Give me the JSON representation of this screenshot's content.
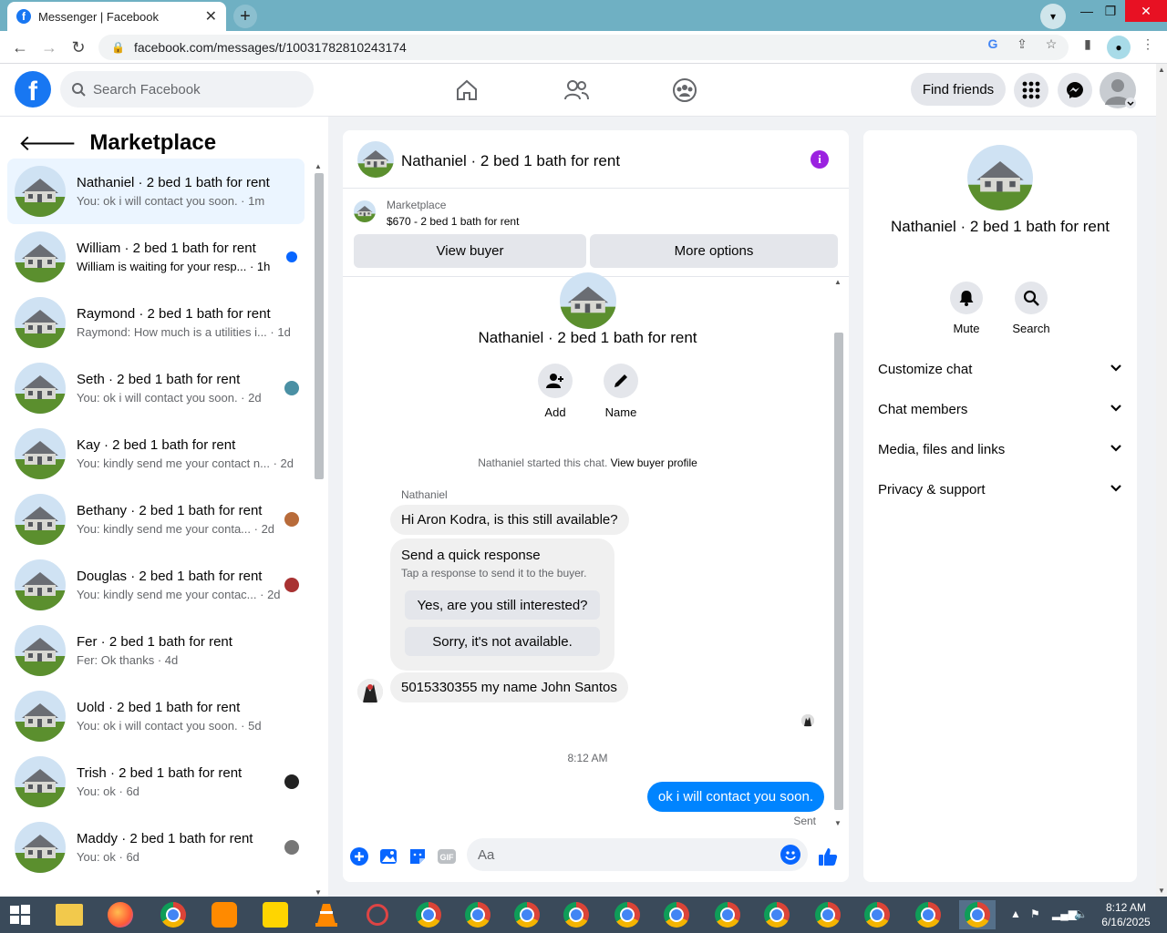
{
  "browser": {
    "tab_title": "Messenger | Facebook",
    "tab_close": "✕",
    "new_tab": "+",
    "url": "facebook.com/messages/t/10031782810243174",
    "win_minimize": "—",
    "win_restore": "❐",
    "win_close": "✕"
  },
  "fbnav": {
    "logo": "f",
    "search_placeholder": "Search Facebook",
    "find_friends": "Find friends"
  },
  "sidebar": {
    "title": "Marketplace",
    "conversations": [
      {
        "name": "Nathaniel · 2 bed 1 bath for rent",
        "preview": "You: ok i will contact you soon. · 1m",
        "active": true
      },
      {
        "name": "William · 2 bed 1 bath for rent",
        "preview": "William is waiting for your resp... · 1h",
        "unread": true
      },
      {
        "name": "Raymond · 2 bed 1 bath for rent",
        "preview": "Raymond: How much is a utilities i... · 1d"
      },
      {
        "name": "Seth · 2 bed 1 bath for rent",
        "preview": "You: ok i will contact you soon. · 2d"
      },
      {
        "name": "Kay · 2 bed 1 bath for rent",
        "preview": "You: kindly send me your contact n... · 2d"
      },
      {
        "name": "Bethany · 2 bed 1 bath for rent",
        "preview": "You: kindly send me your conta... · 2d"
      },
      {
        "name": "Douglas · 2 bed 1 bath for rent",
        "preview": "You: kindly send me your contac... · 2d"
      },
      {
        "name": "Fer · 2 bed 1 bath for rent",
        "preview": "Fer: Ok thanks · 4d"
      },
      {
        "name": "Uold · 2 bed 1 bath for rent",
        "preview": "You: ok i will contact you soon. · 5d"
      },
      {
        "name": "Trish · 2 bed 1 bath for rent",
        "preview": "You: ok · 6d"
      },
      {
        "name": "Maddy · 2 bed 1 bath for rent",
        "preview": "You: ok · 6d"
      }
    ]
  },
  "chat": {
    "title": "Nathaniel · 2 bed 1 bath for rent",
    "marketplace_label": "Marketplace",
    "listing": "$670 - 2 bed 1 bath for rent",
    "view_buyer": "View buyer",
    "more_options": "More options",
    "thread_title": "Nathaniel · 2 bed 1 bath for rent",
    "add_label": "Add",
    "name_label": "Name",
    "started_text": "Nathaniel started this chat.",
    "view_buyer_profile": "View buyer profile",
    "sender_name": "Nathaniel",
    "msg1": "Hi Aron Kodra, is this still available?",
    "quick_title": "Send a quick response",
    "quick_sub": "Tap a response to send it to the buyer.",
    "quick_opt1": "Yes, are you still interested?",
    "quick_opt2": "Sorry, it's not available.",
    "msg2": "5015330355 my name John Santos",
    "timestamp": "8:12 AM",
    "my_msg": "ok i will contact you soon.",
    "status": "Sent",
    "composer_placeholder": "Aa"
  },
  "details": {
    "title": "Nathaniel · 2 bed 1 bath for rent",
    "mute": "Mute",
    "search": "Search",
    "sections": [
      "Customize chat",
      "Chat members",
      "Media, files and links",
      "Privacy & support"
    ]
  },
  "taskbar": {
    "time": "8:12 AM",
    "date": "6/16/2025"
  },
  "colors": {
    "fb_blue": "#1877f2",
    "messenger_blue": "#0084ff",
    "info_purple": "#9b22e0",
    "active_row": "#ebf5ff"
  }
}
